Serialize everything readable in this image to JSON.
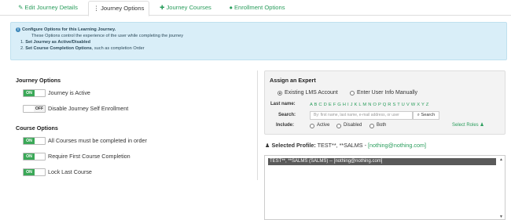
{
  "tabs": [
    {
      "icon": "✎",
      "label": "Edit Journey Details"
    },
    {
      "icon": "⋮",
      "label": "Journey Options"
    },
    {
      "icon": "✚",
      "label": "Journey Courses"
    },
    {
      "icon": "●",
      "label": "Enrollment Options"
    }
  ],
  "info": {
    "title": "Configure Options for this Learning Journey.",
    "subtitle": "These Options control the experience of the user while completing the journey",
    "item1_num": "1.",
    "item1_bold": "Set Journey as Active/Disabled",
    "item2_num": "2.",
    "item2_bold": "Set Course Completion Options",
    "item2_rest": ", such as completion Order"
  },
  "journey_options": {
    "heading": "Journey Options",
    "items": [
      {
        "state": "ON",
        "label": "Journey is Active"
      },
      {
        "state": "OFF",
        "label": "Disable Journey Self Enrollment"
      }
    ]
  },
  "course_options": {
    "heading": "Course Options",
    "items": [
      {
        "state": "ON",
        "label": "All Courses must be completed in order"
      },
      {
        "state": "ON",
        "label": "Require First Course Completion"
      },
      {
        "state": "ON",
        "label": "Lock Last Course"
      }
    ]
  },
  "expert": {
    "heading": "Assign an Expert",
    "radio_existing": "Existing LMS Account",
    "radio_manual": "Enter User Info Manually",
    "lastname_label": "Last name:",
    "letters": "A B C D E F G H I J K L M N O P Q R S T U V W X Y Z",
    "search_label": "Search:",
    "search_placeholder": "By: first name, last name, e-mail address, or user",
    "search_button": "Search",
    "include_label": "Include:",
    "include_active": "Active",
    "include_disabled": "Disabled",
    "include_both": "Both",
    "select_roles": "Select Roles"
  },
  "selected_profile": {
    "label": "Selected Profile:",
    "name": "TEST**, **SALMS - ",
    "email": "[nothing@nothing.com]"
  },
  "listbox": {
    "option": "TEST**, **SALMS (SALMS) -- [nothing@nothing.com]"
  },
  "colors": {
    "accent": "#2a9d5c",
    "on": "#3aa857",
    "info_bg": "#d9eef8"
  }
}
